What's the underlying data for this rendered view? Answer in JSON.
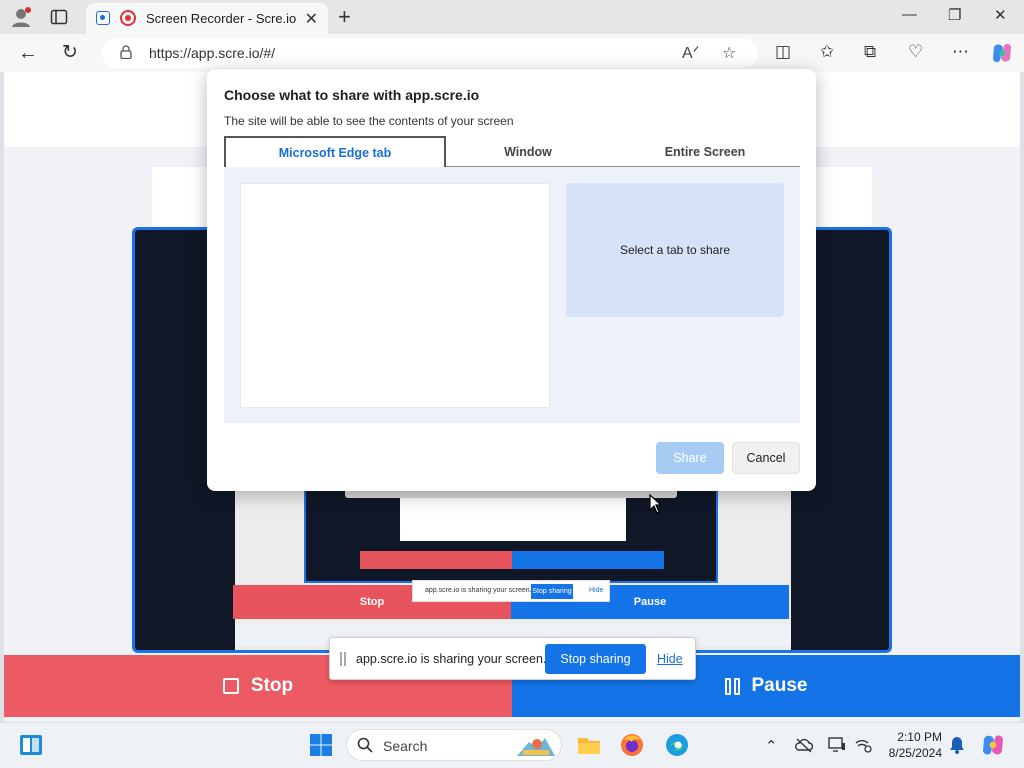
{
  "browser": {
    "tab_title": "Screen Recorder - Scre.io",
    "url": "https://app.scre.io/#/",
    "new_tab_glyph": "+",
    "window_controls": [
      "—",
      "❐",
      "✕"
    ]
  },
  "dialog": {
    "title": "Choose what to share with app.scre.io",
    "subtitle": "The site will be able to see the contents of your screen",
    "tabs": [
      {
        "label": "Microsoft Edge tab",
        "active": true
      },
      {
        "label": "Window",
        "active": false
      },
      {
        "label": "Entire Screen",
        "active": false
      }
    ],
    "hint": "Select a tab to share",
    "share_label": "Share",
    "cancel_label": "Cancel"
  },
  "app": {
    "stop_label": "Stop",
    "pause_label": "Pause",
    "preview_stop_label": "Stop",
    "preview_pause_label": "Pause"
  },
  "sharebar": {
    "message": "app.scre.io is sharing your screen.",
    "stop_label": "Stop sharing",
    "hide_label": "Hide"
  },
  "mini_sharebar": {
    "message": "app.scre.io is sharing your screen.",
    "stop_label": "Stop sharing",
    "hide_label": "Hide"
  },
  "taskbar": {
    "search_label": "Search",
    "time": "2:10 PM",
    "date": "8/25/2024"
  },
  "colors": {
    "accent": "#1473e6",
    "stop_red": "#ec5a63",
    "record_red": "#e0303a"
  }
}
